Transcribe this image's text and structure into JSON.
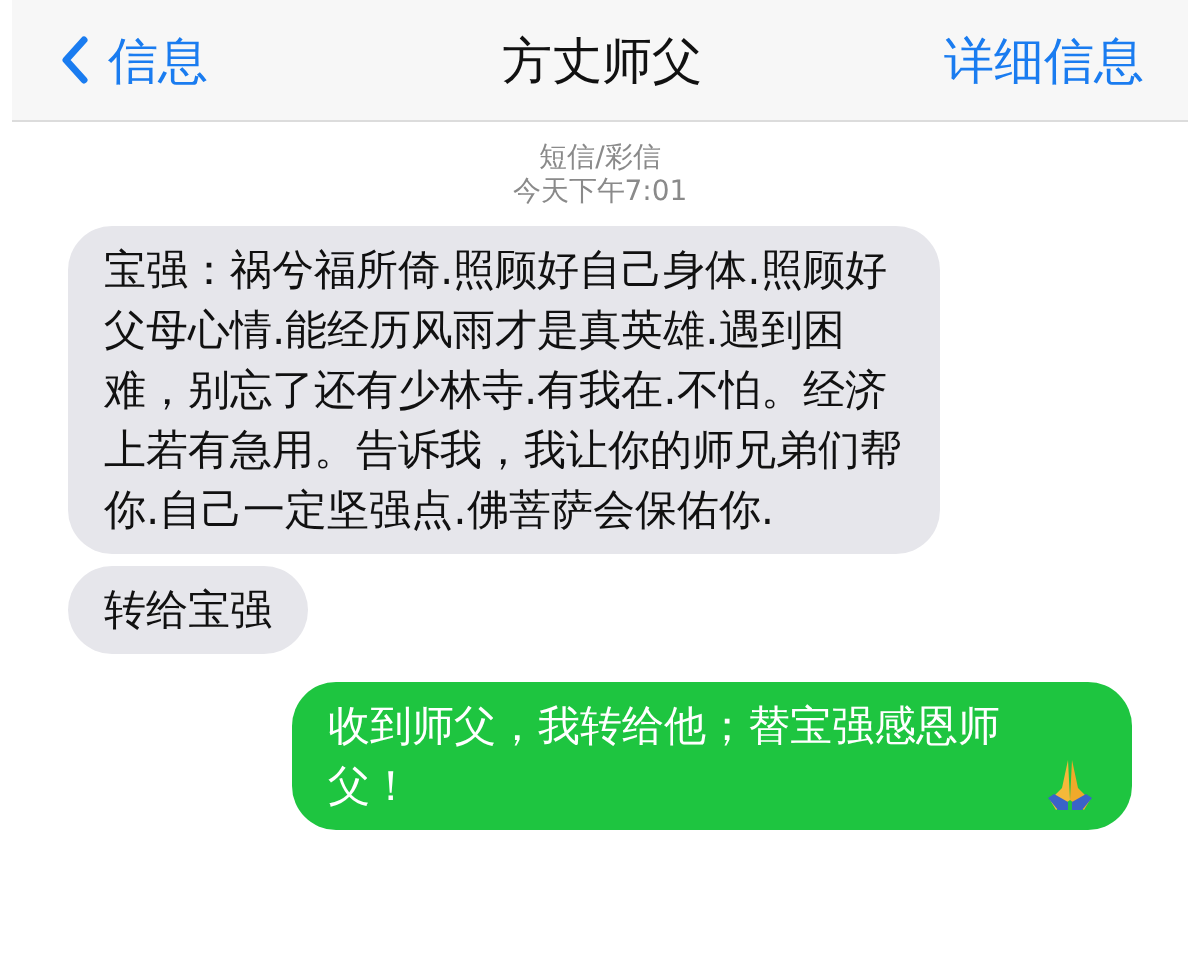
{
  "nav": {
    "back": "信息",
    "title": "方丈师父",
    "details": "详细信息"
  },
  "header": {
    "service": "短信/彩信",
    "time": "今天下午7:01"
  },
  "messages": [
    {
      "kind": "incoming",
      "text": "宝强：祸兮福所倚.照顾好自己身体.照顾好父母心情.能经历风雨才是真英雄.遇到困难，别忘了还有少林寺.有我在.不怕。经济上若有急用。告诉我，我让你的师兄弟们帮你.自己一定坚强点.佛菩萨会保佑你."
    },
    {
      "kind": "incoming",
      "text": "转给宝强"
    },
    {
      "kind": "outgoing",
      "text": "收到师父，我转给他；替宝强感恩师父！",
      "emoji": true
    }
  ]
}
